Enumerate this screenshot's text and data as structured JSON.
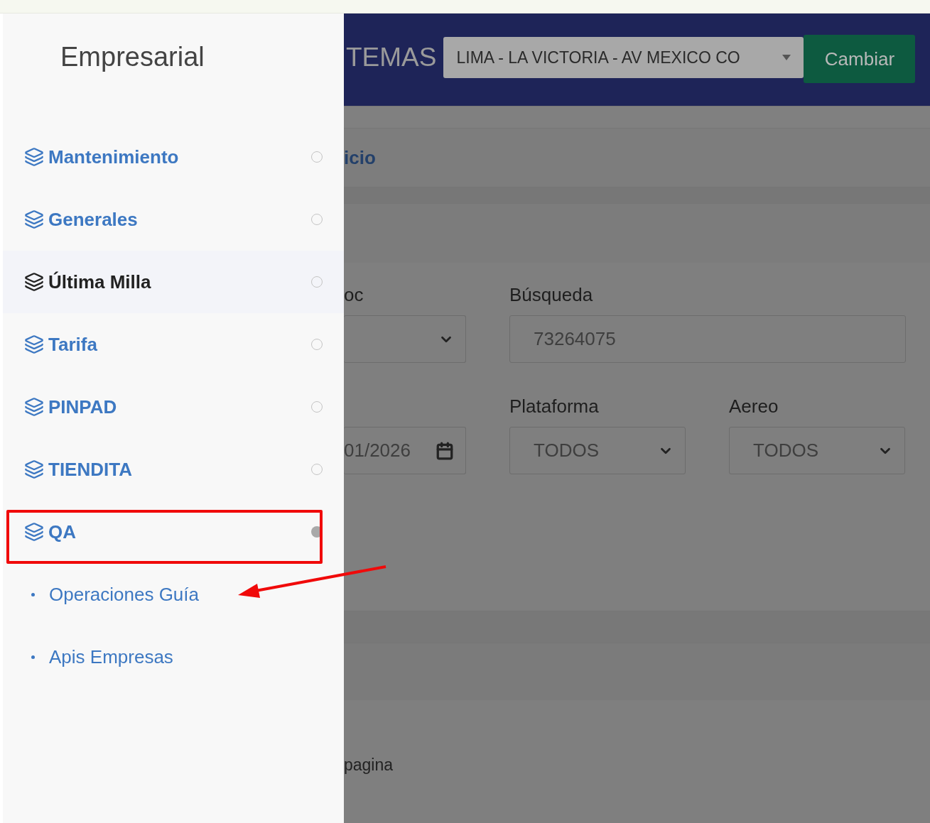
{
  "sidebar": {
    "title": "Empresarial",
    "items": [
      {
        "label": "Mantenimiento",
        "active": false,
        "expanded": false,
        "highlighted": false
      },
      {
        "label": "Generales",
        "active": false,
        "expanded": false,
        "highlighted": false
      },
      {
        "label": "Última Milla",
        "active": true,
        "expanded": false,
        "highlighted": false
      },
      {
        "label": "Tarifa",
        "active": false,
        "expanded": false,
        "highlighted": false
      },
      {
        "label": "PINPAD",
        "active": false,
        "expanded": false,
        "highlighted": false
      },
      {
        "label": "TIENDITA",
        "active": false,
        "expanded": false,
        "highlighted": false
      },
      {
        "label": "QA",
        "active": false,
        "expanded": true,
        "highlighted": true,
        "children": [
          {
            "label": "Operaciones Guía"
          },
          {
            "label": "Apis Empresas"
          }
        ]
      }
    ]
  },
  "header": {
    "title": "TEMAS",
    "location": "LIMA - LA VICTORIA - AV MEXICO CO",
    "button": "Cambiar"
  },
  "breadcrumb": "icio",
  "form": {
    "rows": [
      [
        {
          "kind": "select",
          "label": "oc"
        },
        {
          "kind": "input",
          "label": "Búsqueda",
          "value": "73264075"
        }
      ],
      [
        {
          "kind": "date",
          "value": "01/2026"
        },
        {
          "kind": "select",
          "label": "Plataforma",
          "value": "TODOS"
        },
        {
          "kind": "select",
          "label": "Aereo",
          "value": "TODOS"
        }
      ]
    ]
  },
  "footer_text": "pagina"
}
